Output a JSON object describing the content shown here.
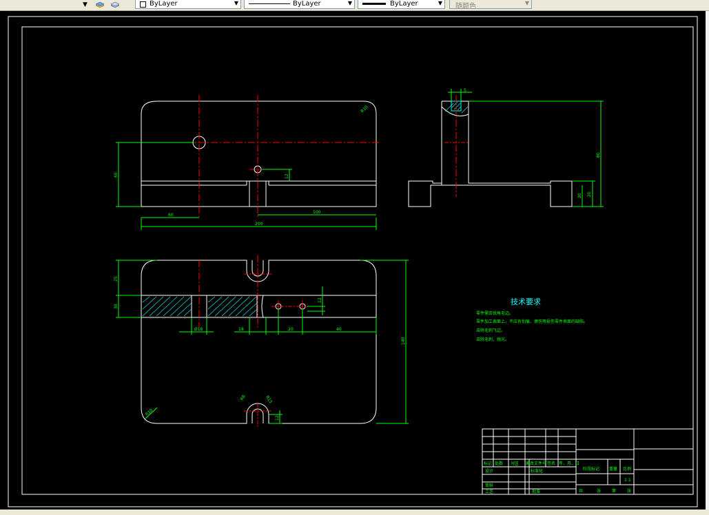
{
  "toolbar": {
    "color_combo": "ByLayer",
    "linetype_combo": "ByLayer",
    "lineweight_combo": "ByLayer",
    "plotstyle_combo": "随颜色"
  },
  "drawing": {
    "dims_top_view": [
      "200",
      "60",
      "100",
      "12",
      "60",
      "R10"
    ],
    "dims_side_view": [
      "5",
      "80",
      "20",
      "20"
    ],
    "dims_plan_view": [
      "25",
      "30",
      "12",
      "Ø18",
      "18",
      "20",
      "40",
      "140",
      "R10",
      "R8",
      "R15",
      "12"
    ],
    "notes_title": "技术要求",
    "notes": [
      "零件需去锐角毛边。",
      "零件加工表面上，不应有划痕、擦伤等损伤零件表面的缺陷。",
      "去除毛刺飞边。",
      "去除毛刺，抛光。"
    ],
    "title_block": {
      "row_headers": [
        "标记",
        "处数",
        "分区",
        "更改文件号",
        "签名",
        "年、月、日"
      ],
      "design": "设计",
      "standardize": "标准化",
      "review": "审核",
      "process": "工艺",
      "approve": "批准",
      "stage_mark": "阶段标记",
      "weight": "重量",
      "scale": "比例",
      "scale_value": "1:1",
      "sheets": [
        "共",
        "张",
        "第",
        "张"
      ]
    }
  }
}
